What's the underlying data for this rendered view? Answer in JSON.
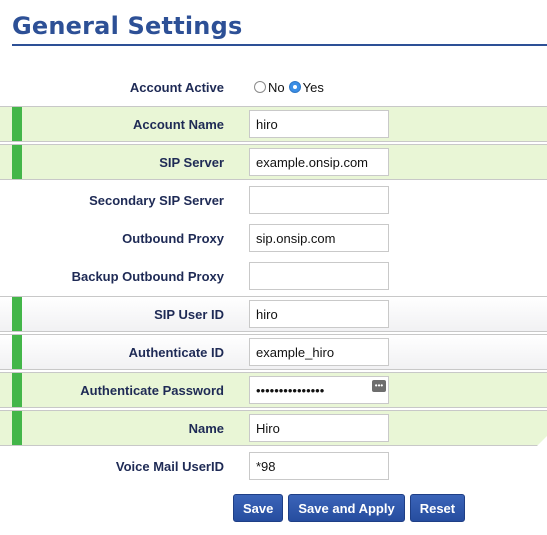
{
  "page": {
    "title": "General Settings"
  },
  "account_active": {
    "label": "Account Active",
    "options": [
      "No",
      "Yes"
    ],
    "selected": "Yes"
  },
  "fields": {
    "account_name": {
      "label": "Account Name",
      "value": "hiro"
    },
    "sip_server": {
      "label": "SIP Server",
      "value": "example.onsip.com"
    },
    "secondary_sip_server": {
      "label": "Secondary SIP Server",
      "value": ""
    },
    "outbound_proxy": {
      "label": "Outbound Proxy",
      "value": "sip.onsip.com"
    },
    "backup_outbound_proxy": {
      "label": "Backup Outbound Proxy",
      "value": ""
    },
    "sip_user_id": {
      "label": "SIP User ID",
      "value": "hiro"
    },
    "authenticate_id": {
      "label": "Authenticate ID",
      "value": "example_hiro"
    },
    "authenticate_password": {
      "label": "Authenticate Password",
      "value": "•••••••••••••••"
    },
    "name": {
      "label": "Name",
      "value": "Hiro"
    },
    "voice_mail_userid": {
      "label": "Voice Mail UserID",
      "value": "*98"
    }
  },
  "buttons": {
    "save": "Save",
    "save_apply": "Save and Apply",
    "reset": "Reset"
  },
  "colors": {
    "title": "#2d5096",
    "accent_bar": "#43b649",
    "row_highlight": "#e9f6d6",
    "button": "#2a55a8"
  }
}
